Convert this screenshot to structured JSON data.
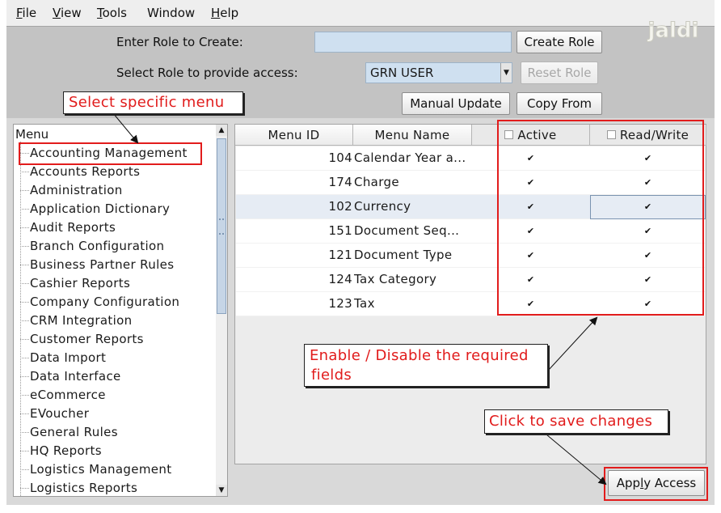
{
  "menubar": {
    "items": [
      {
        "mnemonic": "F",
        "rest": "ile"
      },
      {
        "mnemonic": "V",
        "rest": "iew"
      },
      {
        "mnemonic": "T",
        "rest": "ools"
      },
      {
        "mnemonic": "",
        "rest": "Window"
      },
      {
        "mnemonic": "H",
        "rest": "elp"
      }
    ]
  },
  "logo": {
    "text": "jaldi"
  },
  "role_panel": {
    "create_label": "Enter Role to Create:",
    "role_input_value": "",
    "create_button": "Create Role",
    "select_label": "Select Role to provide access:",
    "selected_role": "GRN USER",
    "reset_button": "Reset Role",
    "manual_update_button": "Manual Update",
    "copy_from_button": "Copy  From"
  },
  "tree": {
    "root_label": "Menu",
    "items": [
      "Accounting Management",
      "Accounts Reports",
      "Administration",
      "Application Dictionary",
      "Audit Reports",
      "Branch Configuration",
      "Business Partner Rules",
      "Cashier Reports",
      "Company Configuration",
      "CRM Integration",
      "Customer Reports",
      "Data Import",
      "Data Interface",
      "eCommerce",
      "EVoucher",
      "General Rules",
      "HQ Reports",
      "Logistics Management",
      "Logistics Reports"
    ]
  },
  "table": {
    "headers": {
      "menu_id": "Menu ID",
      "menu_name": "Menu Name",
      "active": "Active",
      "read_write": "Read/Write"
    },
    "rows": [
      {
        "id": "104",
        "name": "Calendar Year a...",
        "active": true,
        "read_write": true
      },
      {
        "id": "174",
        "name": "Charge",
        "active": true,
        "read_write": true
      },
      {
        "id": "102",
        "name": "Currency",
        "active": true,
        "read_write": true
      },
      {
        "id": "151",
        "name": "Document Seq...",
        "active": true,
        "read_write": true
      },
      {
        "id": "121",
        "name": "Document Type",
        "active": true,
        "read_write": true
      },
      {
        "id": "124",
        "name": "Tax Category",
        "active": true,
        "read_write": true
      },
      {
        "id": "123",
        "name": "Tax",
        "active": true,
        "read_write": true
      }
    ]
  },
  "apply_button": {
    "mnemonic_before": "App",
    "mnemonic": "l",
    "after": "y Access"
  },
  "annotations": {
    "select_menu": "Select specific menu",
    "enable_fields_line1": "Enable / Disable the required",
    "enable_fields_line2": "fields",
    "save_changes": "Click to save changes"
  },
  "colors": {
    "annotation_red": "#e21c1c",
    "input_blue": "#cfe0f0",
    "panel_gray": "#c3c3c3"
  }
}
